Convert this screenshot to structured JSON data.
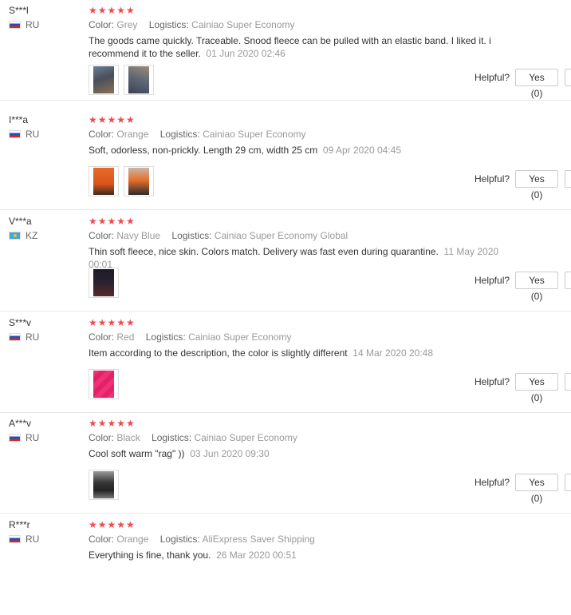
{
  "labels": {
    "color": "Color:",
    "logistics": "Logistics:",
    "helpful": "Helpful?",
    "yes": "Yes (0)"
  },
  "reviews": [
    {
      "user": "S***l",
      "country": "RU",
      "stars": "★★★★★",
      "color": "Grey",
      "logistics": "Cainiao Super Economy",
      "text": "The goods came quickly. Traceable. Snood fleece can be pulled with an elastic band. I liked it. i recommend it to the seller.",
      "date": "01 Jun 2020 02:46",
      "photo_count": 2
    },
    {
      "user": "I***a",
      "country": "RU",
      "stars": "★★★★★",
      "color": "Orange",
      "logistics": "Cainiao Super Economy",
      "text": "Soft, odorless, non-prickly. Length 29 cm, width 25 cm",
      "date": "09 Apr 2020 04:45",
      "photo_count": 2
    },
    {
      "user": "V***a",
      "country": "KZ",
      "stars": "★★★★★",
      "color": "Navy Blue",
      "logistics": "Cainiao Super Economy Global",
      "text": "Thin soft fleece, nice skin. Colors match. Delivery was fast even during quarantine.",
      "date": "11 May 2020 00:01",
      "photo_count": 1
    },
    {
      "user": "S***v",
      "country": "RU",
      "stars": "★★★★★",
      "color": "Red",
      "logistics": "Cainiao Super Economy",
      "text": "Item according to the description, the color is slightly different",
      "date": "14 Mar 2020 20:48",
      "photo_count": 1
    },
    {
      "user": "A***v",
      "country": "RU",
      "stars": "★★★★★",
      "color": "Black",
      "logistics": "Cainiao Super Economy",
      "text": "Cool soft warm \"rag\" ))",
      "date": "03 Jun 2020 09:30",
      "photo_count": 1
    },
    {
      "user": "R***r",
      "country": "RU",
      "stars": "★★★★★",
      "color": "Orange",
      "logistics": "AliExpress Saver Shipping",
      "text": "Everything is fine, thank you.",
      "date": "26 Mar 2020 00:51",
      "photo_count": 0
    }
  ]
}
